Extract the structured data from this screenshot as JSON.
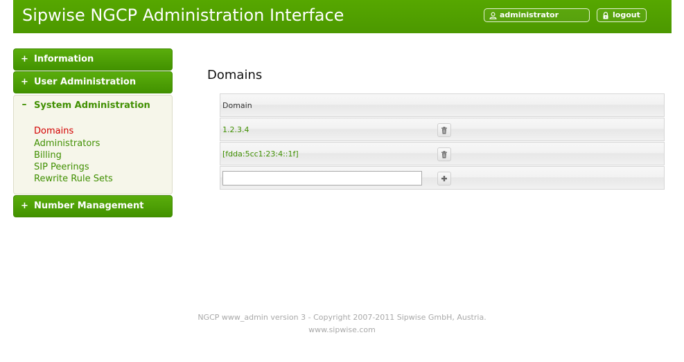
{
  "header": {
    "title": "Sipwise NGCP Administration Interface",
    "user_label": "administrator",
    "logout_label": "logout",
    "user_icon": "user-icon",
    "logout_icon": "lock-icon",
    "background": "#4fa000"
  },
  "sidebar": {
    "information": {
      "sign": "+",
      "label": "Information"
    },
    "user_admin": {
      "sign": "+",
      "label": "User Administration"
    },
    "system_admin": {
      "sign": "–",
      "label": "System Administration",
      "links": [
        {
          "label": "Domains",
          "active": true
        },
        {
          "label": "Administrators"
        },
        {
          "label": "Billing"
        },
        {
          "label": "SIP Peerings"
        },
        {
          "label": "Rewrite Rule Sets"
        }
      ]
    },
    "number_mgmt": {
      "sign": "+",
      "label": "Number Management"
    }
  },
  "main": {
    "title": "Domains",
    "column_header": "Domain",
    "domains": [
      {
        "name": "1.2.3.4",
        "action_icon": "trash-icon"
      },
      {
        "name": "[fdda:5cc1:23:4::1f]",
        "action_icon": "trash-icon"
      }
    ],
    "new_domain": {
      "value": "",
      "action_icon": "plus-icon"
    }
  },
  "footer": {
    "line1": "NGCP www_admin version 3 - Copyright 2007-2011 Sipwise GmbH, Austria.",
    "line2": "www.sipwise.com"
  },
  "colors": {
    "accent": "#4fa000",
    "link": "#3f8f00",
    "active_link": "#d30000"
  }
}
